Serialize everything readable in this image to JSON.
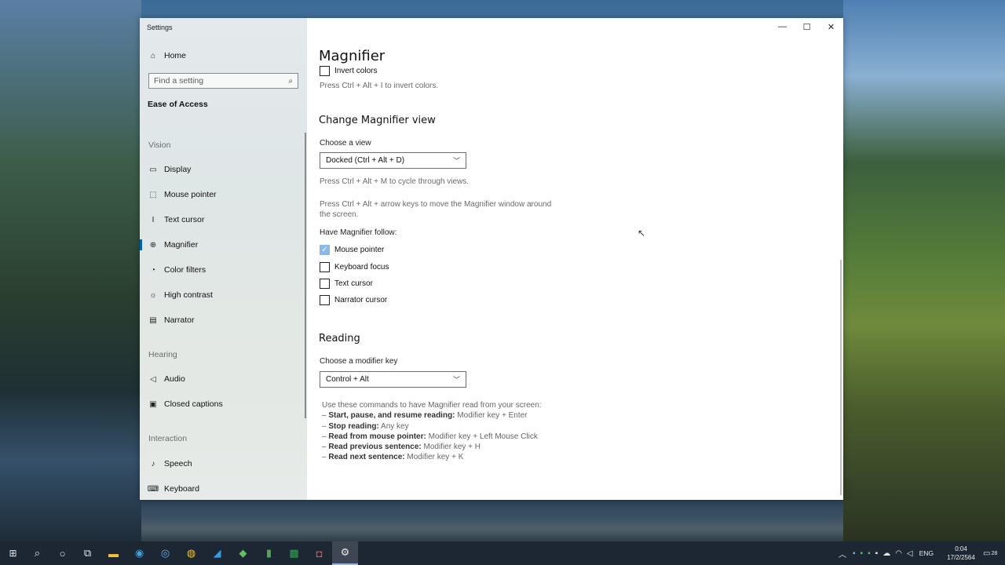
{
  "window": {
    "title": "Settings",
    "controls": {
      "minimize": "—",
      "maximize": "☐",
      "close": "✕"
    }
  },
  "sidebar": {
    "home_label": "Home",
    "search_placeholder": "Find a setting",
    "category_label": "Ease of Access",
    "sections": [
      {
        "heading": "Vision",
        "items": [
          {
            "label": "Display",
            "icon": "display-icon"
          },
          {
            "label": "Mouse pointer",
            "icon": "mouse-pointer-icon"
          },
          {
            "label": "Text cursor",
            "icon": "text-cursor-icon"
          },
          {
            "label": "Magnifier",
            "icon": "magnifier-icon",
            "active": true
          },
          {
            "label": "Color filters",
            "icon": "color-filters-icon"
          },
          {
            "label": "High contrast",
            "icon": "high-contrast-icon"
          },
          {
            "label": "Narrator",
            "icon": "narrator-icon"
          }
        ]
      },
      {
        "heading": "Hearing",
        "items": [
          {
            "label": "Audio",
            "icon": "audio-icon"
          },
          {
            "label": "Closed captions",
            "icon": "closed-captions-icon"
          }
        ]
      },
      {
        "heading": "Interaction",
        "items": [
          {
            "label": "Speech",
            "icon": "speech-icon"
          },
          {
            "label": "Keyboard",
            "icon": "keyboard-icon"
          }
        ]
      }
    ]
  },
  "main": {
    "page_title": "Magnifier",
    "invert": {
      "label": "Invert colors",
      "checked": false,
      "hint": "Press Ctrl + Alt + I to invert colors."
    },
    "view_section": {
      "heading": "Change Magnifier view",
      "choose_label": "Choose a view",
      "selected_view": "Docked (Ctrl + Alt + D)",
      "hint_cycle": "Press Ctrl + Alt + M to cycle through views.",
      "hint_move_line1": "Press Ctrl + Alt + arrow keys to move the Magnifier window around",
      "hint_move_line2": "the screen.",
      "follow_label": "Have Magnifier follow:",
      "follow_options": [
        {
          "label": "Mouse pointer",
          "checked": true
        },
        {
          "label": "Keyboard focus",
          "checked": false
        },
        {
          "label": "Text cursor",
          "checked": false
        },
        {
          "label": "Narrator cursor",
          "checked": false
        }
      ]
    },
    "reading_section": {
      "heading": "Reading",
      "modifier_label": "Choose a modifier key",
      "modifier_value": "Control + Alt",
      "intro": "Use these commands to have Magnifier read from your screen:",
      "commands": [
        {
          "name": "Start, pause, and resume reading:",
          "keys": "Modifier key + Enter"
        },
        {
          "name": "Stop reading:",
          "keys": "Any key"
        },
        {
          "name": "Read from mouse pointer:",
          "keys": "Modifier key + Left Mouse Click"
        },
        {
          "name": "Read previous sentence:",
          "keys": "Modifier key + H"
        },
        {
          "name": "Read next sentence:",
          "keys": "Modifier key + K"
        }
      ]
    }
  },
  "taskbar": {
    "language": "ENG",
    "time": "0:04",
    "date": "17/2/2564",
    "notification_count": "28"
  },
  "colors": {
    "accent": "#0063b1",
    "checkbox_checked": "#8cb8e8",
    "taskbar": "#1d2733"
  }
}
